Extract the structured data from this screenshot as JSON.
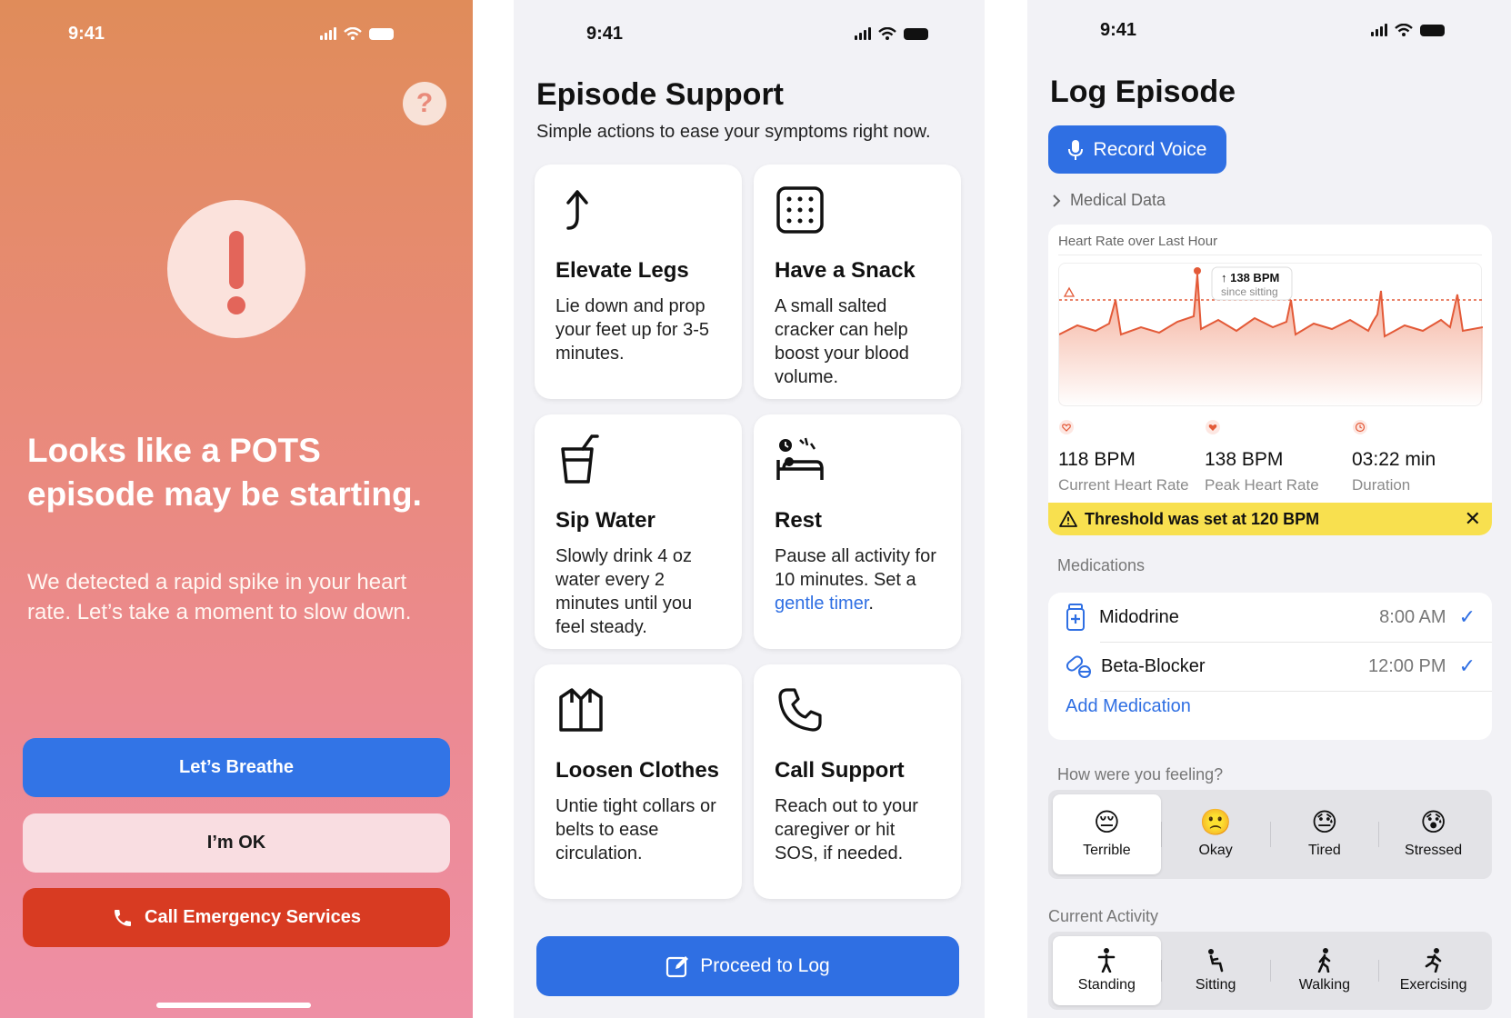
{
  "screen1": {
    "time": "9:41",
    "help_icon": "?",
    "headline": "Looks like a POTS episode may be starting.",
    "message": "We detected a rapid spike in your heart rate. Let’s take a moment to slow down.",
    "buttons": {
      "breathe": "Let’s Breathe",
      "ok": "I’m OK",
      "call": "Call Emergency Services"
    },
    "colors": {
      "breathe": "#3274e6",
      "call": "#d83b22"
    }
  },
  "screen2": {
    "time": "9:41",
    "title": "Episode Support",
    "subtitle": "Simple actions to ease your symptoms right now.",
    "cards": [
      {
        "icon": "arrow-up-icon",
        "title": "Elevate Legs",
        "desc": "Lie down and prop your feet up for 3-5 minutes."
      },
      {
        "icon": "cracker-icon",
        "title": "Have a Snack",
        "desc": "A small salted cracker can help boost your blood volume."
      },
      {
        "icon": "water-cup-icon",
        "title": "Sip Water",
        "desc": "Slowly drink 4 oz water every 2 minutes until you feel steady."
      },
      {
        "icon": "rest-bed-icon",
        "title": "Rest",
        "desc": "Pause all activity for 10 minutes. Set a ",
        "link": "gentle timer",
        "desc_end": "."
      },
      {
        "icon": "shirt-icon",
        "title": "Loosen Clothes",
        "desc": "Untie tight collars or belts to ease circulation."
      },
      {
        "icon": "phone-icon",
        "title": "Call Support",
        "desc": "Reach out to your caregiver or hit SOS, if needed."
      }
    ],
    "proceed": "Proceed to Log"
  },
  "screen3": {
    "time": "9:41",
    "title": "Log Episode",
    "record": "Record Voice",
    "medical_data": "Medical Data",
    "hr_title": "Heart Rate over Last Hour",
    "peak_tag": "138 BPM",
    "peak_sub": "since sitting",
    "stats": [
      {
        "value": "118 BPM",
        "label": "Current Heart Rate"
      },
      {
        "value": "138 BPM",
        "label": "Peak Heart Rate"
      },
      {
        "value": "03:22 min",
        "label": "Duration"
      }
    ],
    "threshold": "Threshold was set at 120 BPM",
    "medications_label": "Medications",
    "medications": [
      {
        "name": "Midodrine",
        "time": "8:00 AM"
      },
      {
        "name": "Beta-Blocker",
        "time": "12:00 PM"
      }
    ],
    "add_medication": "Add Medication",
    "feeling_label": "How were you feeling?",
    "feelings": [
      {
        "emoji": "😔",
        "label": "Terrible"
      },
      {
        "emoji": "🙁",
        "label": "Okay"
      },
      {
        "emoji": "😓",
        "label": "Tired"
      },
      {
        "emoji": "😰",
        "label": "Stressed"
      }
    ],
    "activity_label": "Current Activity",
    "activities": [
      {
        "label": "Standing"
      },
      {
        "label": "Sitting"
      },
      {
        "label": "Walking"
      },
      {
        "label": "Exercising"
      }
    ]
  }
}
